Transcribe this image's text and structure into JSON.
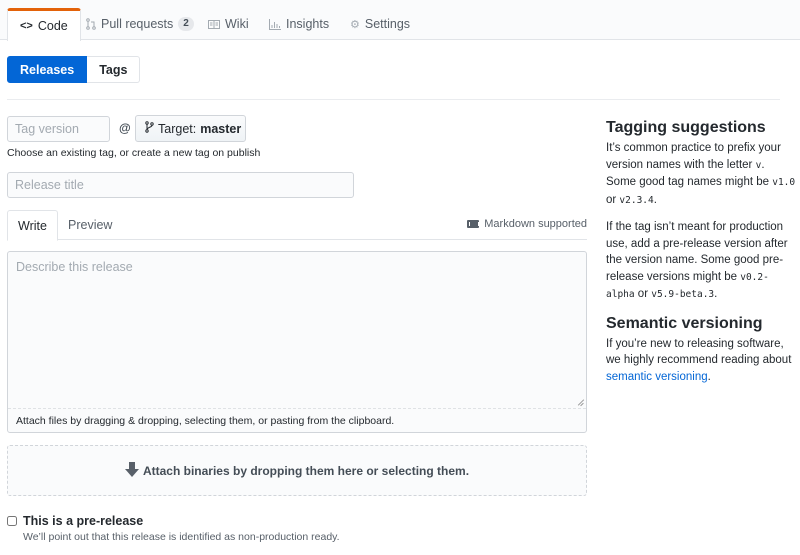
{
  "reponav": {
    "items": [
      {
        "label": "Code",
        "icon": "code-icon",
        "selected": true
      },
      {
        "label": "Pull requests",
        "icon": "git-pull-request-icon",
        "count": "2"
      },
      {
        "label": "Wiki",
        "icon": "book-icon"
      },
      {
        "label": "Insights",
        "icon": "graph-icon"
      },
      {
        "label": "Settings",
        "icon": "gear-icon"
      }
    ]
  },
  "subnav": {
    "releases_label": "Releases",
    "tags_label": "Tags"
  },
  "form": {
    "tag_placeholder": "Tag version",
    "tag_value": "",
    "at_symbol": "@",
    "target_prefix": "Target:",
    "target_branch": "master",
    "tag_note": "Choose an existing tag, or create a new tag on publish",
    "title_placeholder": "Release title",
    "title_value": "",
    "tabs": {
      "write": "Write",
      "preview": "Preview"
    },
    "markdown_hint": "Markdown supported",
    "body_placeholder": "Describe this release",
    "body_value": "",
    "attach_files_text": "Attach files by dragging & dropping, selecting them, or pasting from the clipboard.",
    "dropzone_text": "Attach binaries by dropping them here or selecting them.",
    "prerelease_label": "This is a pre-release",
    "prerelease_note": "We’ll point out that this release is identified as non-production ready.",
    "prerelease_checked": false
  },
  "sidebar": {
    "tagging_title": "Tagging suggestions",
    "tagging_p1_a": "It’s common practice to prefix your version names with the letter ",
    "tagging_p1_code1": "v",
    "tagging_p1_b": ". Some good tag names might be ",
    "tagging_p1_code2": "v1.0",
    "tagging_p1_c": " or ",
    "tagging_p1_code3": "v2.3.4",
    "tagging_p1_d": ".",
    "tagging_p2_a": "If the tag isn’t meant for production use, add a pre-release version after the version name. Some good pre-release versions might be ",
    "tagging_p2_code1": "v0.2-alpha",
    "tagging_p2_b": " or ",
    "tagging_p2_code2": "v5.9-beta.3",
    "tagging_p2_c": ".",
    "semver_title": "Semantic versioning",
    "semver_text": "If you’re new to releasing software, we highly recommend reading about ",
    "semver_link": "semantic versioning",
    "semver_end": "."
  }
}
